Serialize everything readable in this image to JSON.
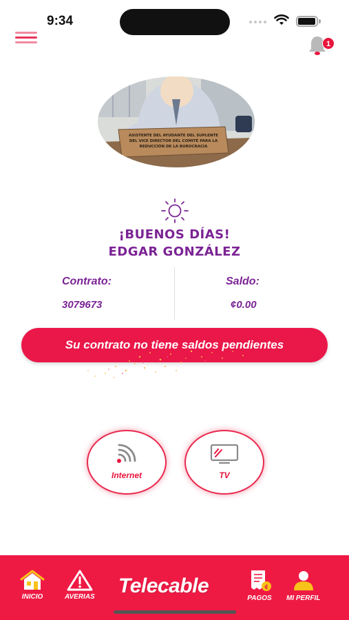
{
  "status_bar": {
    "time": "9:34"
  },
  "header": {
    "menu_icon": "hamburger-menu-icon",
    "notification_icon": "bell-icon",
    "notification_count": "1"
  },
  "banner": {
    "image_icon": "cartoon-bureaucrat-illustration",
    "sign_text": "ASISTENTE DEL AYUDANTE DEL SUPLENTE DEL VICE DIRECTOR DEL COMITÉ PARA LA REDUCCIÓN DE LA BUROCRACIA"
  },
  "greeting": {
    "icon": "sun-icon",
    "line1": "¡BUENOS DÍAS!",
    "line2": "EDGAR GONZÁLEZ"
  },
  "account": {
    "contract_label": "Contrato:",
    "contract_value": "3079673",
    "balance_label": "Saldo:",
    "balance_value": "¢0.00"
  },
  "status_message": "Su contrato no tiene saldos pendientes",
  "services": [
    {
      "label": "Internet",
      "icon": "wifi-signal-icon"
    },
    {
      "label": "TV",
      "icon": "television-icon"
    }
  ],
  "bottom_nav": {
    "items": [
      {
        "label": "INICIO",
        "icon": "home-icon"
      },
      {
        "label": "AVERIAS",
        "icon": "warning-triangle-icon"
      },
      {
        "label": "PAGOS",
        "icon": "receipt-icon"
      },
      {
        "label": "MI PERFIL",
        "icon": "user-icon"
      }
    ],
    "brand": "Telecable"
  },
  "colors": {
    "primary_red": "#ea1749",
    "purple": "#7b2394",
    "yellow": "#f7c21a"
  }
}
